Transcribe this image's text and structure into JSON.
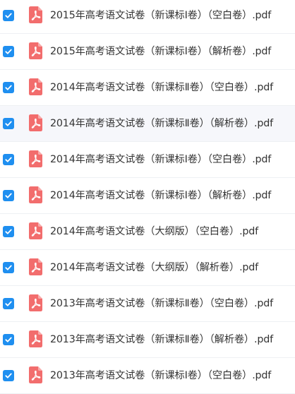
{
  "colors": {
    "checkbox": "#1f8ff0",
    "pdf_icon": "#f26d6d",
    "text": "#333333",
    "row_divider": "#eef0f3",
    "row_highlight": "#f6f7fb"
  },
  "icons": {
    "checkbox": "check-icon",
    "file": "pdf-file-icon"
  },
  "files": [
    {
      "name": "2015年高考语文试卷（新课标Ⅰ卷）（空白卷）.pdf",
      "checked": true
    },
    {
      "name": "2015年高考语文试卷（新课标Ⅰ卷）（解析卷）.pdf",
      "checked": true
    },
    {
      "name": "2014年高考语文试卷（新课标Ⅱ卷）（空白卷）.pdf",
      "checked": true
    },
    {
      "name": "2014年高考语文试卷（新课标Ⅱ卷）（解析卷）.pdf",
      "checked": true
    },
    {
      "name": "2014年高考语文试卷（新课标Ⅰ卷）（空白卷）.pdf",
      "checked": true
    },
    {
      "name": "2014年高考语文试卷（新课标Ⅰ卷）（解析卷）.pdf",
      "checked": true
    },
    {
      "name": "2014年高考语文试卷（大纲版）（空白卷）.pdf",
      "checked": true
    },
    {
      "name": "2014年高考语文试卷（大纲版）（解析卷）.pdf",
      "checked": true
    },
    {
      "name": "2013年高考语文试卷（新课标Ⅱ卷）（空白卷）.pdf",
      "checked": true
    },
    {
      "name": "2013年高考语文试卷（新课标Ⅱ卷）（解析卷）.pdf",
      "checked": true
    },
    {
      "name": "2013年高考语文试卷（新课标Ⅰ卷）（空白卷）.pdf",
      "checked": true
    }
  ]
}
